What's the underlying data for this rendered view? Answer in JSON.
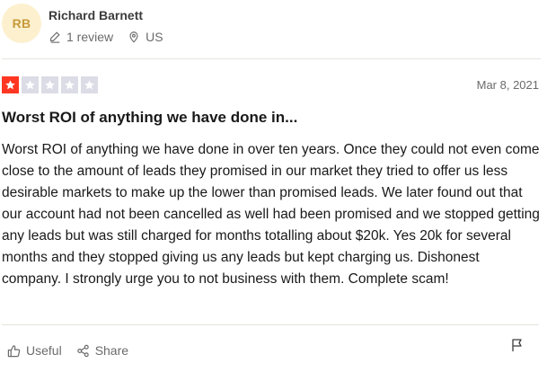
{
  "reviewer": {
    "initials": "RB",
    "name": "Richard Barnett",
    "review_count": "1 review",
    "country": "US",
    "avatar_bg": "#fcf0cf",
    "avatar_fg": "#c79a3a"
  },
  "review": {
    "rating": 1,
    "rating_max": 5,
    "star_color": "#ff3722",
    "date": "Mar 8, 2021",
    "title": "Worst ROI of anything we have done in...",
    "body": "Worst ROI of anything we have done in over ten years. Once they could not even come close to the amount of leads they promised in our market they tried to offer us less desirable markets to make up the lower than promised leads. We later found out that our account had not been cancelled as well had been promised and we stopped getting any leads but was still charged for months totalling about $20k. Yes 20k for several months and they stopped giving us any leads but kept charging us. Dishonest company. I strongly urge you to not business with them. Complete scam!"
  },
  "actions": {
    "useful_label": "Useful",
    "share_label": "Share",
    "useful_icon": "thumbs-up-icon",
    "share_icon": "share-icon",
    "flag_icon": "flag-icon"
  }
}
